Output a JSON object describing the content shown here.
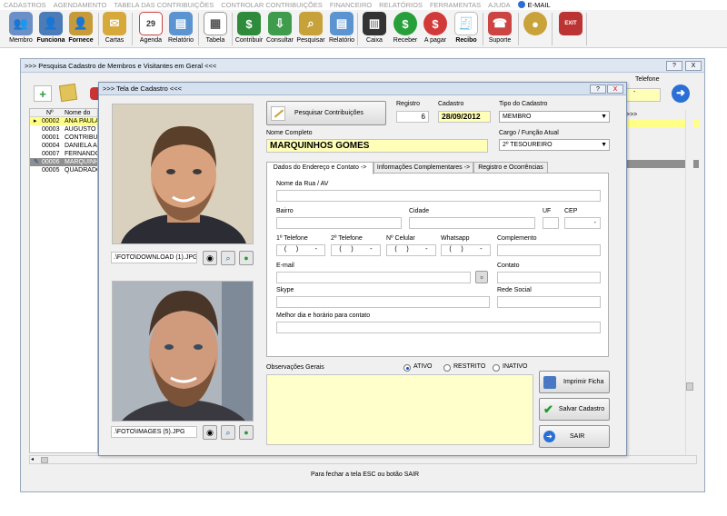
{
  "menu": [
    "CADASTROS",
    "AGENDAMENTO",
    "TABELA DAS CONTRIBUIÇÕES",
    "CONTROLAR CONTRIBUIÇÕES",
    "FINANCEIRO",
    "RELATÓRIOS",
    "FERRAMENTAS",
    "AJUDA",
    "E-MAIL"
  ],
  "toolbar": {
    "membro": "Membro",
    "funciona": "Funciona",
    "fornece": "Fornece",
    "cartas": "Cartas",
    "agenda": "Agenda",
    "agenda_day": "29",
    "relatorio1": "Relatório",
    "tabela": "Tabela",
    "contribuir": "Contribuir",
    "consultar": "Consultar",
    "pesquisar": "Pesquisar",
    "relatorio2": "Relatório",
    "caixa": "Caixa",
    "receber": "Receber",
    "apagar": "A pagar",
    "recibo": "Recibo",
    "suporte": "Suporte",
    "exit_text": "EXIT"
  },
  "main_window": {
    "title": ">>> Pesquisa Cadastro de Membros e Visitantes em Geral <<<",
    "telefone_label": "Telefone",
    "arrows": ">>>",
    "footer": "Para fechar a tela ESC ou botão SAIR",
    "min_btn": "?",
    "close_btn": "X",
    "grid": {
      "headers": [
        "Nº",
        "Nome do M"
      ],
      "rows": [
        {
          "n": "00002",
          "nome": "ANA PAULA",
          "state": "selected"
        },
        {
          "n": "00003",
          "nome": "AUGUSTO",
          "state": ""
        },
        {
          "n": "00001",
          "nome": "CONTRIBUI",
          "state": ""
        },
        {
          "n": "00004",
          "nome": "DANIELA AI",
          "state": ""
        },
        {
          "n": "00007",
          "nome": "FERNANDO",
          "state": ""
        },
        {
          "n": "00006",
          "nome": "MARQUINH",
          "state": "highlight"
        },
        {
          "n": "00005",
          "nome": "QUADRADO",
          "state": ""
        }
      ]
    }
  },
  "cad": {
    "title": ">>> Tela de Cadastro <<<",
    "help_btn": "?",
    "close_btn": "X",
    "photo1_path": ".\\FOTO\\DOWNLOAD (1).JPG",
    "photo2_path": ".\\FOTO\\IMAGES (5).JPG",
    "btn_pesquisar": "Pesquisar Contribuições",
    "registro_label": "Registro",
    "registro": "6",
    "cadastro_label": "Cadastro",
    "cadastro": "28/09/2012",
    "tipo_label": "Tipo do Cadastro",
    "tipo": "MEMBRO",
    "nome_label": "Nome Completo",
    "nome": "MARQUINHOS GOMES",
    "cargo_label": "Cargo / Função Atual",
    "cargo": "2º TESOUREIRO",
    "tabs": [
      "Dados do Endereço e Contato ->",
      "Informações Complementares ->",
      "Registro e Ocorrências"
    ],
    "fields": {
      "rua": "Nome da Rua / AV",
      "bairro": "Bairro",
      "cidade": "Cidade",
      "uf": "UF",
      "cep": "CEP",
      "cep_mask": "-",
      "tel1": "1º Telefone",
      "tel2": "2º Telefone",
      "cel": "Nº Celular",
      "whats": "Whatsapp",
      "compl": "Complemento",
      "phone_mask": "(  )    -",
      "email": "E-mail",
      "contato": "Contato",
      "skype": "Skype",
      "rede": "Rede Social",
      "melhor": "Melhor dia e horário para contato"
    },
    "obs_label": "Observações Gerais",
    "status": [
      "ATIVO",
      "RESTRITO",
      "INATIVO"
    ],
    "status_selected": "ATIVO",
    "btn_imprimir": "Imprimir Ficha",
    "btn_salvar": "Salvar Cadastro",
    "btn_sair": "SAIR"
  },
  "colors": {
    "accent": "#1f4fb4",
    "highlight": "#ffff88",
    "title_bar": "#d6e1ef"
  }
}
